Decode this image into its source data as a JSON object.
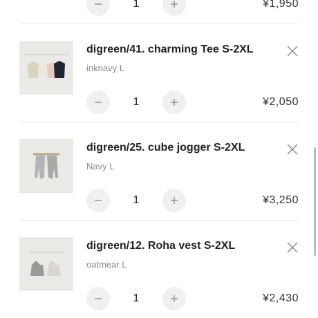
{
  "cart": {
    "items": [
      {
        "name": "",
        "variant": "",
        "quantity": "1",
        "price": "¥1,950",
        "thumbnail_icon": "product-photo"
      },
      {
        "name": "digreen/41. charming Tee S-2XL",
        "variant": "inknavy L",
        "quantity": "1",
        "price": "¥2,050",
        "thumbnail_icon": "product-photo-tees"
      },
      {
        "name": "digreen/25. cube jogger S-2XL",
        "variant": "Navy L",
        "quantity": "1",
        "price": "¥3,250",
        "thumbnail_icon": "product-photo-joggers"
      },
      {
        "name": "digreen/12. Roha vest S-2XL",
        "variant": "oatmear L",
        "quantity": "1",
        "price": "¥2,430",
        "thumbnail_icon": "product-photo-vests"
      }
    ],
    "controls": {
      "minus_icon": "minus-icon",
      "plus_icon": "plus-icon",
      "remove_icon": "close-icon"
    },
    "colors": {
      "stepper_bg": "#f0f0f0",
      "divider": "#e6e6e6",
      "variant_text": "#8a8a8a"
    }
  }
}
